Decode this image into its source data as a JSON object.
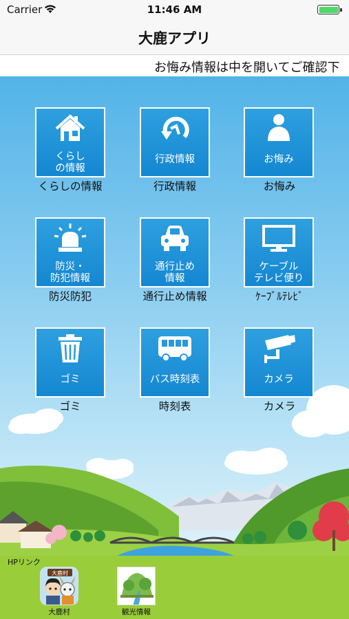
{
  "status_bar": {
    "carrier": "Carrier",
    "time": "11:46 AM"
  },
  "nav": {
    "title": "大鹿アプリ"
  },
  "ticker": {
    "text": "お悔み情報は中を開いてご確認下"
  },
  "menu": [
    {
      "tile_label": "くらし\nの情報",
      "caption": "くらしの情報",
      "icon": "house-icon"
    },
    {
      "tile_label": "行政情報",
      "caption": "行政情報",
      "icon": "circular-arrow-icon"
    },
    {
      "tile_label": "お悔み",
      "caption": "お悔み",
      "icon": "person-icon"
    },
    {
      "tile_label": "防災・\n防犯情報",
      "caption": "防災防犯",
      "icon": "siren-icon"
    },
    {
      "tile_label": "通行止め\n情報",
      "caption": "通行止め情報",
      "icon": "car-icon"
    },
    {
      "tile_label": "ケーブル\nテレビ便り",
      "caption": "ｹｰﾌﾞﾙﾃﾚﾋﾞ",
      "icon": "tv-icon"
    },
    {
      "tile_label": "ゴミ",
      "caption": "ゴミ",
      "icon": "trash-can-icon"
    },
    {
      "tile_label": "バス時刻表",
      "caption": "時刻表",
      "icon": "bus-icon"
    },
    {
      "tile_label": "カメラ",
      "caption": "カメラ",
      "icon": "camera-icon"
    }
  ],
  "footer": {
    "heading": "HPリンク",
    "links": [
      {
        "label": "大鹿村",
        "badge": "大鹿村",
        "icon": "village-mascot-icon"
      },
      {
        "label": "観光情報",
        "icon": "landscape-icon"
      }
    ]
  }
}
